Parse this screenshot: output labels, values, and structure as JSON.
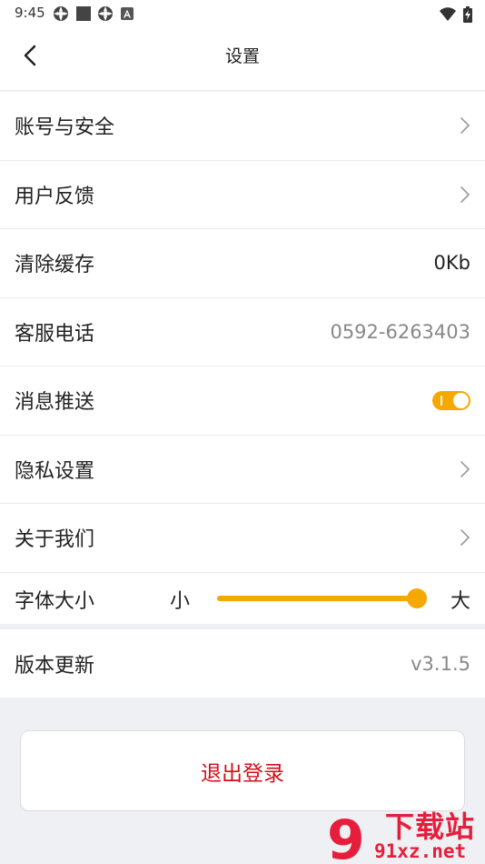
{
  "status_bar": {
    "time": "9:45",
    "icons": [
      "settings-gear-icon",
      "stop-square-icon",
      "settings-gear-icon",
      "app-a-icon"
    ],
    "right_icons": [
      "wifi-icon",
      "battery-charging-icon"
    ]
  },
  "header": {
    "title": "设置",
    "back_icon": "chevron-left-icon"
  },
  "settings": {
    "items": [
      {
        "label": "账号与安全",
        "type": "link"
      },
      {
        "label": "用户反馈",
        "type": "link"
      },
      {
        "label": "清除缓存",
        "type": "value",
        "value": "0Kb"
      },
      {
        "label": "客服电话",
        "type": "value",
        "value": "0592-6263403"
      },
      {
        "label": "消息推送",
        "type": "toggle",
        "enabled": true
      },
      {
        "label": "隐私设置",
        "type": "link"
      },
      {
        "label": "关于我们",
        "type": "link"
      }
    ],
    "font_size": {
      "label": "字体大小",
      "min_label": "小",
      "max_label": "大",
      "level": 1.0
    },
    "version": {
      "label": "版本更新",
      "value": "v3.1.5"
    }
  },
  "logout": {
    "label": "退出登录"
  },
  "watermark": {
    "digit": "9",
    "title": "下载站",
    "domain": "91xz.net"
  },
  "colors": {
    "accent": "#f5a800",
    "danger": "#d0101a",
    "watermark": "#e61e3c",
    "background": "#eef0f4"
  }
}
